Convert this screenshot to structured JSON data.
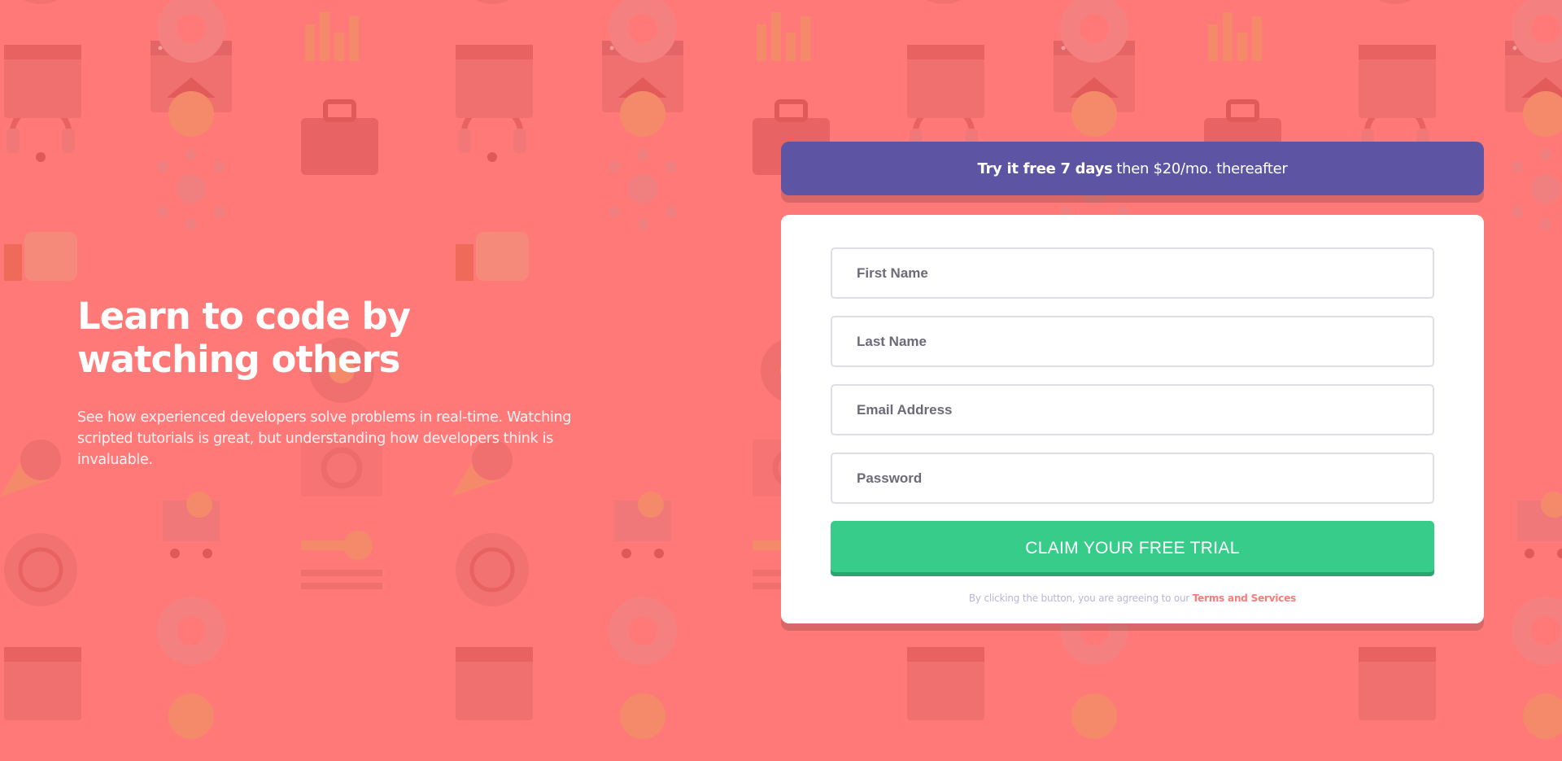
{
  "hero": {
    "title": "Learn to code by watching others",
    "description": "See how experienced developers solve problems in real-time. Watching scripted tutorials is great, but understanding how developers think is invaluable."
  },
  "banner": {
    "bold_text": "Try it free 7 days",
    "rest_text": "then $20/mo. thereafter"
  },
  "form": {
    "first_name_placeholder": "First Name",
    "last_name_placeholder": "Last Name",
    "email_placeholder": "Email Address",
    "password_placeholder": "Password",
    "submit_label": "CLAIM YOUR FREE TRIAL",
    "terms_prefix": "By clicking the button, you are agreeing to our",
    "terms_link": "Terms and Services"
  },
  "colors": {
    "background": "#ff7979",
    "banner": "#5e54a4",
    "button": "#38cc8b",
    "accent_link": "#ff7979"
  }
}
